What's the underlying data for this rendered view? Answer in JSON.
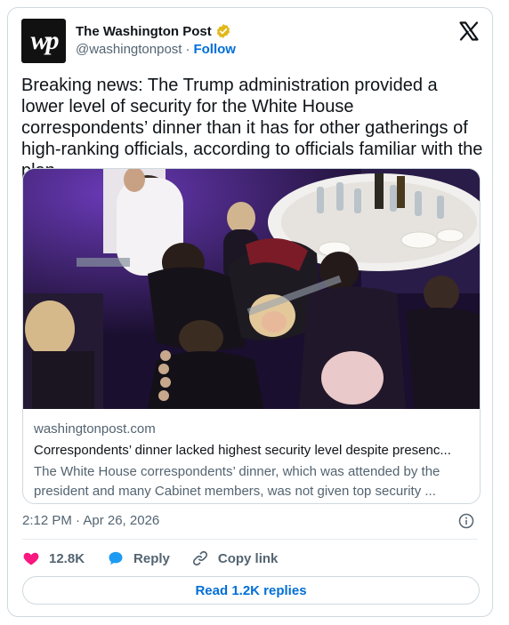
{
  "author": {
    "avatar_text": "wp",
    "name": "The Washington Post",
    "handle": "@washingtonpost",
    "separator": "·",
    "follow_label": "Follow",
    "verified_color": "#e2b719"
  },
  "tweet": {
    "text": "Breaking news: The Trump administration provided a lower level of security for the White House correspondents’ dinner than it has for other gatherings of high-ranking officials, according to officials familiar with the plan."
  },
  "link_card": {
    "domain": "washingtonpost.com",
    "title": "Correspondents’ dinner lacked highest security level despite presenc...",
    "description": "The White House correspondents’ dinner, which was attended by the president and many Cabinet members, was not given top security ..."
  },
  "timestamp": "2:12 PM · Apr 26, 2026",
  "actions": {
    "likes": "12.8K",
    "reply_label": "Reply",
    "copy_label": "Copy link"
  },
  "read_replies_label": "Read 1.2K replies",
  "colors": {
    "accent": "#006fd6",
    "like": "#f91880",
    "reply_icon": "#1d9bf0",
    "muted": "#536471"
  }
}
